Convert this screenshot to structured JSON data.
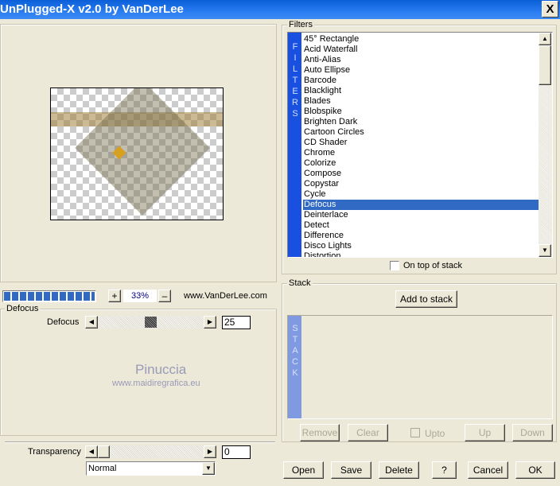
{
  "window": {
    "title": "UnPlugged-X v2.0 by VanDerLee",
    "close_label": "X"
  },
  "preview": {
    "zoom_in": "+",
    "zoom_value": "33%",
    "zoom_out": "–",
    "website": "www.VanDerLee.com",
    "progress_percent": 100
  },
  "params": {
    "group_label": "Defocus",
    "defocus_label": "Defocus",
    "defocus_value": "25",
    "defocus_slider_fraction": 0.3,
    "transparency_label": "Transparency",
    "transparency_value": "0",
    "blend_mode": "Normal"
  },
  "watermark": {
    "name": "Pinuccia",
    "url": "www.maidiregrafica.eu"
  },
  "filters": {
    "group_label": "Filters",
    "strip_label": "FILTERS",
    "items": [
      "45° Rectangle",
      "Acid Waterfall",
      "Anti-Alias",
      "Auto Ellipse",
      "Barcode",
      "Blacklight",
      "Blades",
      "Blobspike",
      "Brighten Dark",
      "Cartoon Circles",
      "CD Shader",
      "Chrome",
      "Colorize",
      "Compose",
      "Copystar",
      "Cycle",
      "Defocus",
      "Deinterlace",
      "Detect",
      "Difference",
      "Disco Lights",
      "Distortion"
    ],
    "selected": "Defocus",
    "on_top_label": "On top of stack",
    "on_top_checked": false
  },
  "stack": {
    "group_label": "Stack",
    "add_label": "Add to stack",
    "strip_label": "STACK",
    "remove": "Remove",
    "clear": "Clear",
    "upto": "Upto",
    "up": "Up",
    "down": "Down"
  },
  "footer": {
    "open": "Open",
    "save": "Save",
    "delete": "Delete",
    "help": "?",
    "cancel": "Cancel",
    "ok": "OK"
  },
  "colors": {
    "title_bar": "#0a5fd8",
    "selection": "#316ac5",
    "filters_strip": "#1a50e0",
    "stack_strip": "#7f9ae0"
  }
}
